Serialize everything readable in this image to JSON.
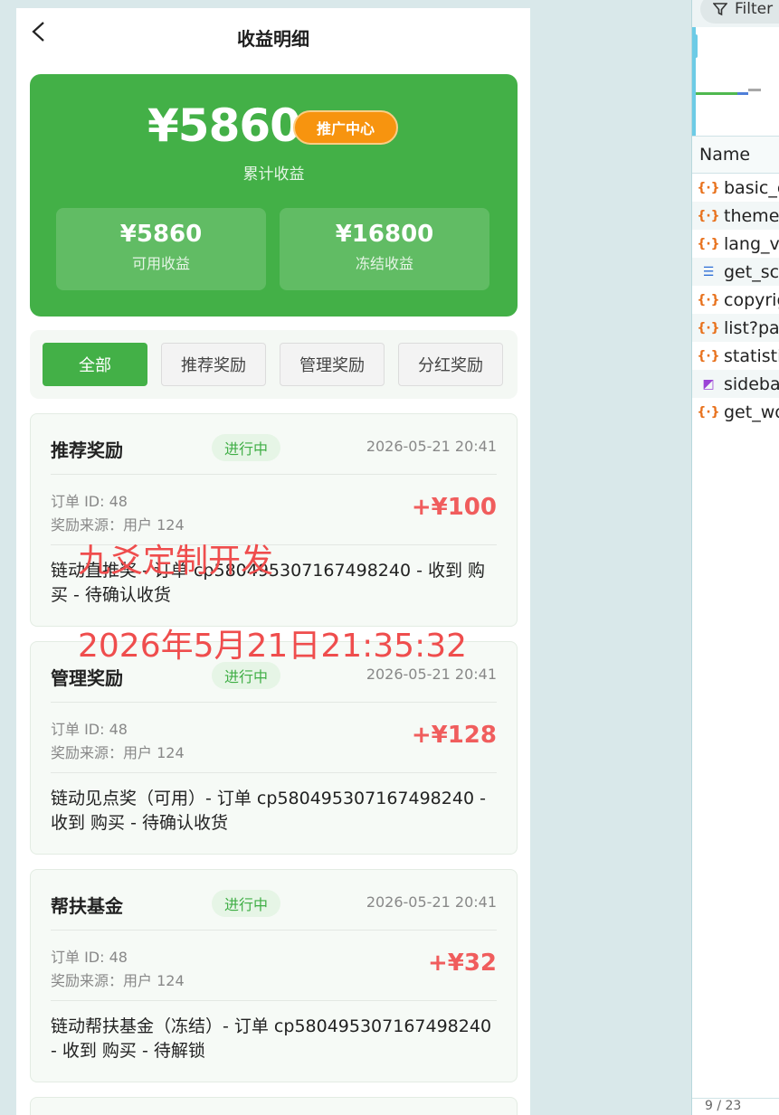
{
  "nav": {
    "title": "收益明细"
  },
  "hero": {
    "total_amount": "¥5860",
    "promo_button": "推广中心",
    "total_label": "累计收益",
    "available": {
      "value": "¥5860",
      "label": "可用收益"
    },
    "frozen": {
      "value": "¥16800",
      "label": "冻结收益"
    }
  },
  "tabs": [
    "全部",
    "推荐奖励",
    "管理奖励",
    "分红奖励"
  ],
  "active_tab": "全部",
  "records": [
    {
      "type": "推荐奖励",
      "status": "进行中",
      "date": "2026-05-21 20:41",
      "order": "订单 ID: 48",
      "source": "奖励来源：用户 124",
      "amount": "+¥100",
      "desc": "链动直推奖 - 订单 cp580495307167498240 - 收到 购买 - 待确认收货"
    },
    {
      "type": "管理奖励",
      "status": "进行中",
      "date": "2026-05-21 20:41",
      "order": "订单 ID: 48",
      "source": "奖励来源：用户 124",
      "amount": "+¥128",
      "desc": "链动见点奖（可用）- 订单 cp580495307167498240 - 收到 购买 - 待确认收货"
    },
    {
      "type": "帮扶基金",
      "status": "进行中",
      "date": "2026-05-21 20:41",
      "order": "订单 ID: 48",
      "source": "奖励来源：用户 124",
      "amount": "+¥32",
      "desc": "链动帮扶基金（冻结）- 订单 cp580495307167498240 - 收到 购买 - 待解锁"
    }
  ],
  "watermark": {
    "line1": "九爻定制开发",
    "line2": "2026年5月21日21:35:32"
  },
  "colors": {
    "primary": "#43b047",
    "promo": "#f7940f",
    "amount": "#f05d5d"
  },
  "devtools": {
    "filter_label": "Filter",
    "name_header": "Name",
    "files": [
      {
        "name": "basic_c",
        "icon": "json-icon"
      },
      {
        "name": "theme",
        "icon": "json-icon"
      },
      {
        "name": "lang_ve",
        "icon": "json-icon"
      },
      {
        "name": "get_scr",
        "icon": "document-icon"
      },
      {
        "name": "copyrig",
        "icon": "json-icon"
      },
      {
        "name": "list?pag",
        "icon": "json-icon"
      },
      {
        "name": "statistic",
        "icon": "json-icon"
      },
      {
        "name": "sidebar",
        "icon": "image-icon"
      },
      {
        "name": "get_wo",
        "icon": "json-icon"
      }
    ],
    "footer": "9 / 23"
  }
}
